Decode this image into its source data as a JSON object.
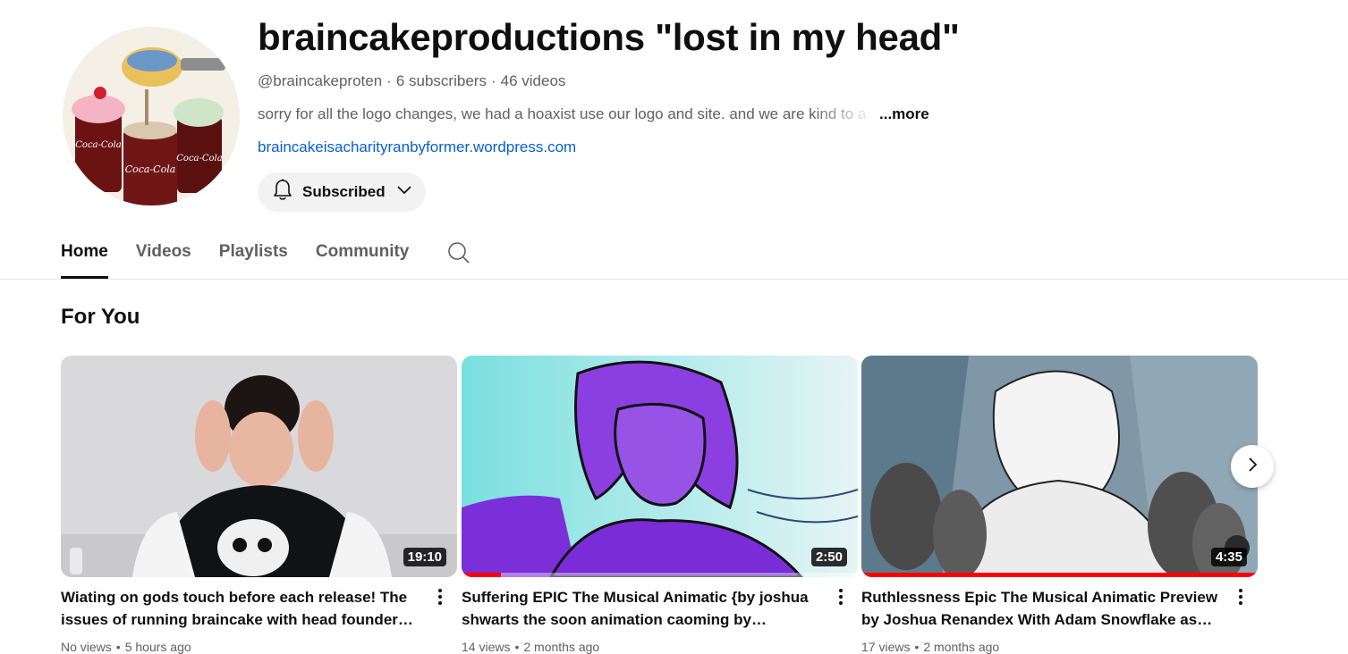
{
  "channel": {
    "name": "braincakeproductions \"lost in my head\"",
    "handle": "@braincakeproten",
    "subscribers": "6 subscribers",
    "videos_count": "46 videos",
    "separator": "·",
    "description": "sorry for all the logo changes, we had a hoaxist use our logo and site. and we are kind to a",
    "more_label": "...more",
    "link": "braincakeisacharityranbyformer.wordpress.com",
    "subscribe_label": "Subscribed",
    "subscribe_icon": "bell-icon",
    "avatar_text": [
      "Coca-Cola",
      "Coca-Cola",
      "Coca-Cola"
    ]
  },
  "tabs": [
    {
      "label": "Home",
      "active": true
    },
    {
      "label": "Videos",
      "active": false
    },
    {
      "label": "Playlists",
      "active": false
    },
    {
      "label": "Community",
      "active": false
    }
  ],
  "section": {
    "title": "For You"
  },
  "videos": [
    {
      "title": "Wiating on gods touch before each release! The issues of running braincake with head founder ada…",
      "duration": "19:10",
      "views": "No views",
      "age": "5 hours ago",
      "watch_progress": 0
    },
    {
      "title": "Suffering EPIC The Musical Animatic {by joshua shwarts the soon animation caoming by homer}&…",
      "duration": "2:50",
      "views": "14 views",
      "age": "2 months ago",
      "watch_progress": 0.1
    },
    {
      "title": "Ruthlessness Epic The Musical Animatic Preview by Joshua Renandex With Adam Snowflake as Posidon",
      "duration": "4:35",
      "views": "17 views",
      "age": "2 months ago",
      "watch_progress": 1.0
    }
  ],
  "meta_separator": "•",
  "colors": {
    "link": "#065fd4",
    "progress": "#ff0000",
    "muted_text": "#606060"
  }
}
